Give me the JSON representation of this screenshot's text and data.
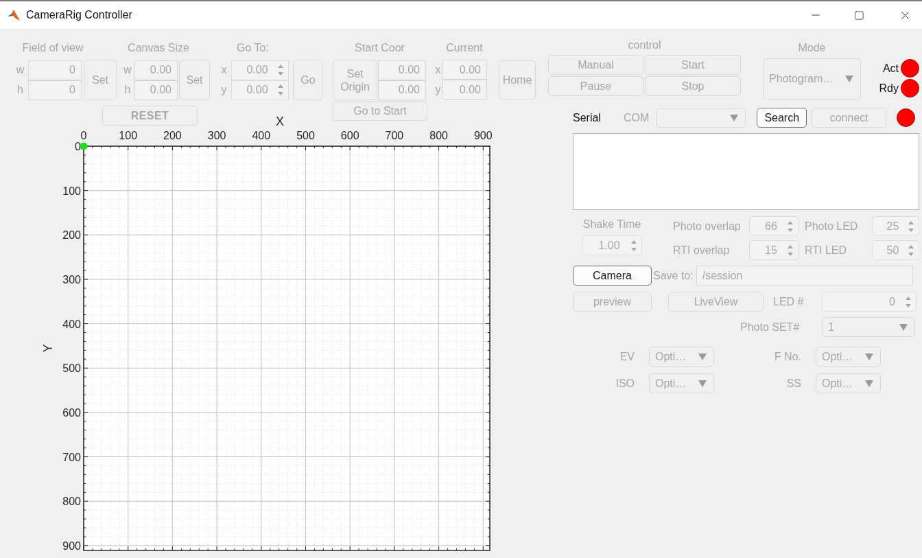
{
  "window": {
    "title": "CameraRig Controller"
  },
  "field_of_view": {
    "title": "Field of view",
    "disabled": true,
    "rows": [
      {
        "label": "w",
        "value": "0"
      },
      {
        "label": "h",
        "value": "0"
      }
    ],
    "button": {
      "label": "Set",
      "disabled": true
    }
  },
  "canvas_size": {
    "title": "Canvas Size",
    "disabled": true,
    "rows": [
      {
        "label": "w",
        "value": "0.00"
      },
      {
        "label": "h",
        "value": "0.00"
      }
    ],
    "button": {
      "label": "Set",
      "disabled": true
    }
  },
  "go_to": {
    "title": "Go To:",
    "disabled": true,
    "rows": [
      {
        "label": "x",
        "value": "0.00"
      },
      {
        "label": "y",
        "value": "0.00"
      }
    ],
    "button": {
      "label": "Go",
      "disabled": true
    }
  },
  "start_coor": {
    "title": "Start Coor",
    "disabled": true,
    "button": {
      "label": "Set Origin",
      "disabled": true
    },
    "values": [
      "0.00",
      "0.00"
    ]
  },
  "current": {
    "title": "Current",
    "disabled": true,
    "rows": [
      {
        "label": "x",
        "value": "0.00"
      },
      {
        "label": "y",
        "value": "0.00"
      }
    ]
  },
  "home_button": {
    "label": "Home",
    "disabled": true
  },
  "control": {
    "title": "control",
    "buttons": [
      {
        "label": "Manual",
        "disabled": true
      },
      {
        "label": "Start",
        "disabled": true
      },
      {
        "label": "Pause",
        "disabled": true
      },
      {
        "label": "Stop",
        "disabled": true
      }
    ]
  },
  "mode": {
    "title": "Mode",
    "value": "Photogram…",
    "disabled": true
  },
  "lamps": [
    {
      "label": "Act",
      "color": "#ff0000"
    },
    {
      "label": "Rdy",
      "color": "#ff0000"
    }
  ],
  "reset_button": {
    "label": "RESET",
    "disabled": true
  },
  "go_to_start_button": {
    "label": "Go to Start",
    "disabled": true
  },
  "plot": {
    "chart_data": {
      "type": "scatter",
      "grid": true,
      "xlabel": "X",
      "ylabel": "Y",
      "xlim": [
        0,
        915
      ],
      "ylim": [
        911,
        0
      ],
      "xticks": [
        0,
        100,
        200,
        300,
        400,
        500,
        600,
        700,
        800,
        900
      ],
      "yticks": [
        0,
        100,
        200,
        300,
        400,
        500,
        600,
        700,
        800,
        900
      ],
      "x": [
        0
      ],
      "series": [
        {
          "color": "#22dd22",
          "values": [
            0
          ]
        }
      ]
    }
  },
  "serial": {
    "label": "Serial",
    "com_label": "COM",
    "com_disabled": true,
    "search_button": {
      "label": "Search",
      "disabled": false
    },
    "connect_button": {
      "label": "connect",
      "disabled": true
    },
    "lamp": {
      "color": "#ff0000"
    }
  },
  "shake_time": {
    "label": "Shake Time",
    "value": "1.00",
    "disabled": true
  },
  "spinners": [
    {
      "label": "Photo overlap",
      "value": "66",
      "disabled": true
    },
    {
      "label": "Photo LED",
      "value": "25",
      "disabled": true
    },
    {
      "label": "RTI overlap",
      "value": "15",
      "disabled": true
    },
    {
      "label": "RTI LED",
      "value": "50",
      "disabled": true
    }
  ],
  "camera_button": {
    "label": "Camera",
    "disabled": false
  },
  "save_to": {
    "label": "Save to:",
    "value": "/session",
    "disabled": true
  },
  "preview_button": {
    "label": "preview",
    "disabled": true
  },
  "liveview_button": {
    "label": "LiveView",
    "disabled": true
  },
  "led": {
    "label": "LED #",
    "value": "0",
    "disabled": true
  },
  "photo_set": {
    "label": "Photo SET#",
    "value": "1",
    "disabled": true
  },
  "settings": [
    {
      "label": "EV",
      "value": "Opti…",
      "disabled": true
    },
    {
      "label": "F No.",
      "value": "Opti…",
      "disabled": true
    },
    {
      "label": "ISO",
      "value": "Opti…",
      "disabled": true
    },
    {
      "label": "SS",
      "value": "Opti…",
      "disabled": true
    }
  ]
}
